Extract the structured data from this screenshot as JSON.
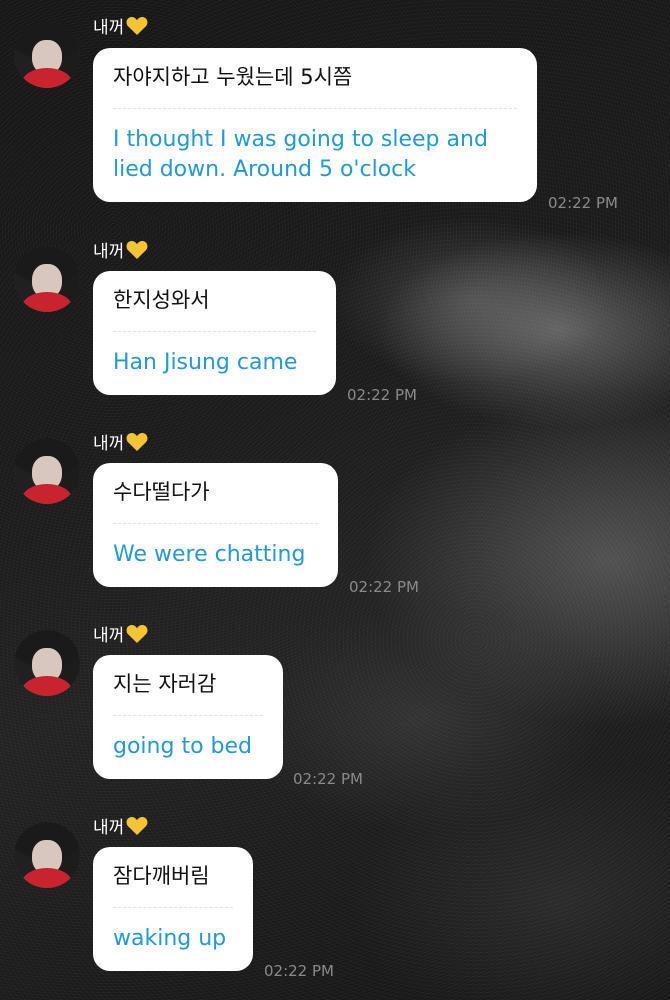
{
  "messages": [
    {
      "sender": "내꺼",
      "sender_emoji": "yellow-heart-icon",
      "original": "자야지하고 누웠는데 5시쯤",
      "translation": "I thought I was going to sleep and lied down. Around 5 o'clock",
      "time": "02:22 PM"
    },
    {
      "sender": "내꺼",
      "sender_emoji": "yellow-heart-icon",
      "original": "한지성와서",
      "translation": "Han Jisung came",
      "time": "02:22 PM"
    },
    {
      "sender": "내꺼",
      "sender_emoji": "yellow-heart-icon",
      "original": "수다떨다가",
      "translation": "We were chatting",
      "time": "02:22 PM"
    },
    {
      "sender": "내꺼",
      "sender_emoji": "yellow-heart-icon",
      "original": "지는 자러감",
      "translation": "going to bed",
      "time": "02:22 PM"
    },
    {
      "sender": "내꺼",
      "sender_emoji": "yellow-heart-icon",
      "original": "잠다깨버림",
      "translation": "waking up",
      "time": "02:22 PM"
    }
  ],
  "colors": {
    "bubble": "#ffffff",
    "translation_text": "#1f9bd7",
    "timestamp": "#8a8a8a",
    "heart": "#f6c432"
  }
}
